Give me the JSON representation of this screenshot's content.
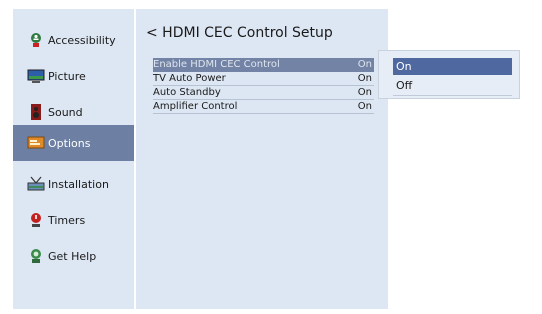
{
  "sidebar": {
    "items": [
      {
        "label": "Accessibility",
        "icon": "accessibility-icon"
      },
      {
        "label": "Picture",
        "icon": "picture-icon"
      },
      {
        "label": "Sound",
        "icon": "sound-icon"
      },
      {
        "label": "Options",
        "icon": "options-icon",
        "selected": true
      },
      {
        "label": "Installation",
        "icon": "installation-icon"
      },
      {
        "label": "Timers",
        "icon": "timers-icon"
      },
      {
        "label": "Get Help",
        "icon": "get-help-icon"
      }
    ]
  },
  "panel": {
    "title": "< HDMI CEC Control Setup",
    "settings": [
      {
        "label": "Enable HDMI CEC Control",
        "value": "On",
        "highlighted": true
      },
      {
        "label": "TV Auto Power",
        "value": "On"
      },
      {
        "label": "Auto Standby",
        "value": "On"
      },
      {
        "label": "Amplifier Control",
        "value": "On"
      }
    ]
  },
  "dropdown": {
    "options": [
      {
        "label": "On",
        "selected": true
      },
      {
        "label": "Off"
      }
    ]
  },
  "colors": {
    "panel_bg": "#dde7f3",
    "sidebar_selected": "#6d7fa3",
    "row_highlight": "#7283a5",
    "dropdown_selected": "#4f68a0"
  }
}
